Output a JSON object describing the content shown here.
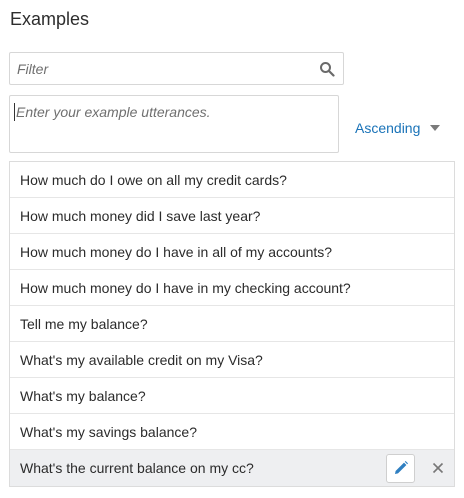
{
  "section": {
    "title": "Examples"
  },
  "filter": {
    "placeholder": "Filter",
    "icon": "search-icon"
  },
  "utterance_input": {
    "placeholder": "Enter your example utterances."
  },
  "sort": {
    "label": "Ascending",
    "icon": "caret-down-icon",
    "accent": "#1a73b8"
  },
  "examples": [
    {
      "text": "How much do I owe on all my credit cards?"
    },
    {
      "text": "How much money did I save last year?"
    },
    {
      "text": "How much money do I have in all of my accounts?"
    },
    {
      "text": "How much money do I have in my checking account?"
    },
    {
      "text": "Tell me my balance?"
    },
    {
      "text": "What's my available credit on my Visa?"
    },
    {
      "text": "What's my balance?"
    },
    {
      "text": "What's my savings balance?"
    },
    {
      "text": "What's the current balance on my cc?",
      "selected": true
    }
  ],
  "row_actions": {
    "edit_icon": "pencil-icon",
    "delete_icon": "close-icon",
    "edit_color": "#2f7fc1"
  }
}
